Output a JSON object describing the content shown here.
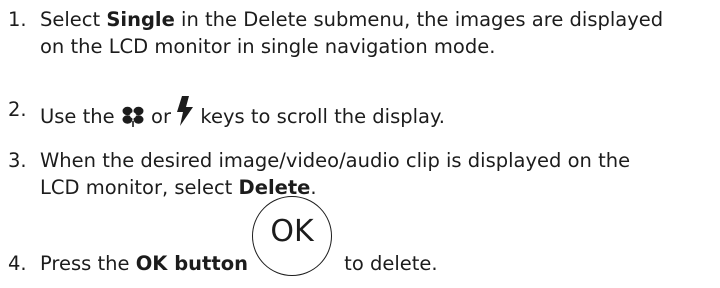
{
  "steps": [
    {
      "number": "1.",
      "line1_pre": "Select ",
      "line1_bold": "Single",
      "line1_post": " in the Delete submenu, the images are displayed",
      "line2": "on the LCD monitor in single navigation mode."
    },
    {
      "number": "2.",
      "pre": "Use the ",
      "mid": " or ",
      "post": " keys to scroll the display.",
      "key1_icon": "macro-flower-icon",
      "key2_icon": "flash-bolt-icon"
    },
    {
      "number": "3.",
      "line1": "When the desired image/video/audio clip is displayed on the",
      "line2_pre": "LCD monitor, select ",
      "line2_bold": "Delete",
      "line2_post": "."
    },
    {
      "number": "4.",
      "pre": "Press the ",
      "bold": "OK button",
      "post": " to delete.",
      "button_label": "OK"
    }
  ]
}
